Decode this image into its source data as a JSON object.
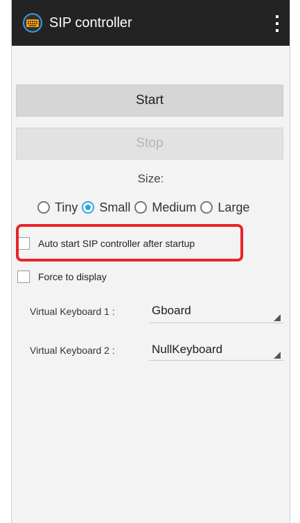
{
  "app": {
    "title": "SIP controller",
    "icon": "keyboard-icon",
    "menu_icon": "overflow-menu-icon"
  },
  "buttons": {
    "start_label": "Start",
    "stop_label": "Stop"
  },
  "size": {
    "label": "Size:",
    "options": [
      "Tiny",
      "Small",
      "Medium",
      "Large"
    ],
    "selected": "Small"
  },
  "checkboxes": {
    "auto_start": {
      "label": "Auto start SIP controller after startup",
      "checked": false
    },
    "force_display": {
      "label": "Force to display",
      "checked": false
    }
  },
  "keyboards": [
    {
      "label": "Virtual Keyboard 1 :",
      "value": "Gboard"
    },
    {
      "label": "Virtual Keyboard 2 :",
      "value": "NullKeyboard"
    }
  ],
  "colors": {
    "accent": "#2aa8e0",
    "highlight": "#e8232b",
    "appbar": "#232323"
  }
}
